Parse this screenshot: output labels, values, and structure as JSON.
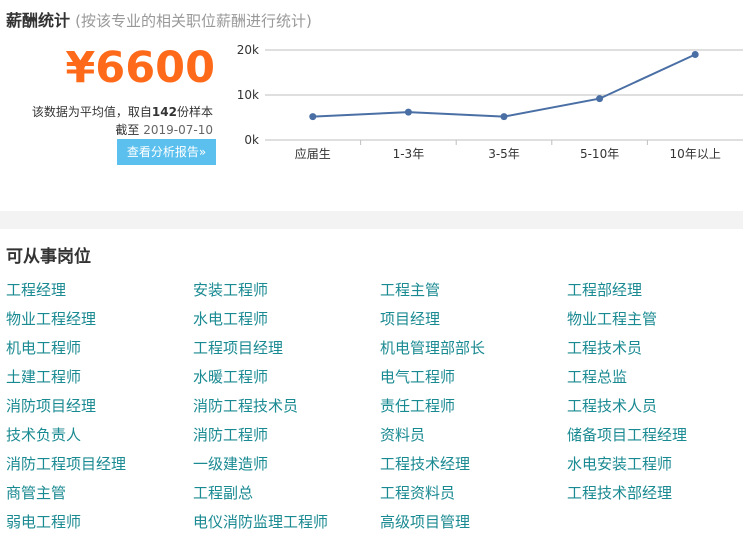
{
  "salary": {
    "title": "薪酬统计",
    "subtitle": "(按该专业的相关职位薪酬进行统计)",
    "average": "¥6600",
    "note_prefix": "该数据为平均值，取自",
    "sample_count": "142",
    "note_suffix": "份样本",
    "date_label": "截至",
    "date": "2019-07-10",
    "report_button": "查看分析报告»"
  },
  "chart_data": {
    "type": "line",
    "categories": [
      "应届生",
      "1-3年",
      "3-5年",
      "5-10年",
      "10年以上"
    ],
    "values": [
      5200,
      6200,
      5200,
      9200,
      19000
    ],
    "ylim": [
      0,
      20000
    ],
    "y_ticks": [
      "0k",
      "10k",
      "20k"
    ],
    "grid": true,
    "line_color": "#4a6fa5",
    "grid_color": "#bfbfbf"
  },
  "jobs": {
    "title": "可从事岗位",
    "items": [
      "工程经理",
      "安装工程师",
      "工程主管",
      "工程部经理",
      "物业工程经理",
      "水电工程师",
      "项目经理",
      "物业工程主管",
      "机电工程师",
      "工程项目经理",
      "机电管理部部长",
      "工程技术员",
      "土建工程师",
      "水暖工程师",
      "电气工程师",
      "工程总监",
      "消防项目经理",
      "消防工程技术员",
      "责任工程师",
      "工程技术人员",
      "技术负责人",
      "消防工程师",
      "资料员",
      "储备项目工程经理",
      "消防工程项目经理",
      "一级建造师",
      "工程技术经理",
      "水电安装工程师",
      "商管主管",
      "工程副总",
      "工程资料员",
      "工程技术部经理",
      "弱电工程师",
      "电仪消防监理工程师",
      "高级项目管理"
    ]
  },
  "colors": {
    "accent_orange": "#ff6a1a",
    "button_blue": "#5bc0ee",
    "link_teal": "#1a8a92"
  }
}
